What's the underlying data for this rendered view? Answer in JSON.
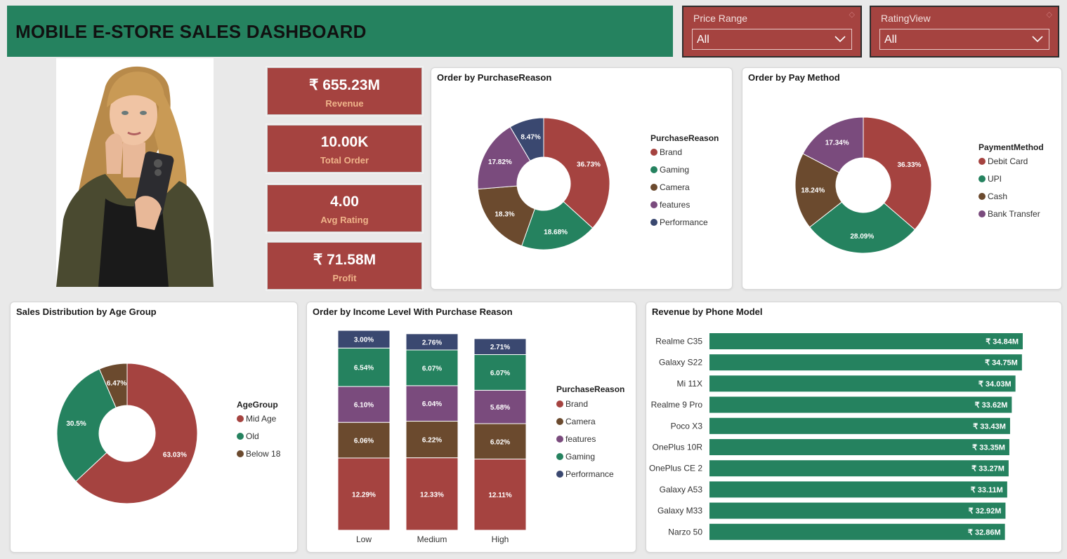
{
  "header": {
    "title": "MOBILE E-STORE SALES DASHBOARD"
  },
  "filters": [
    {
      "label": "Price Range",
      "value": "All"
    },
    {
      "label": "RatingView",
      "value": "All"
    }
  ],
  "kpis": [
    {
      "value": "₹ 655.23M",
      "label": "Revenue"
    },
    {
      "value": "10.00K",
      "label": "Total Order"
    },
    {
      "value": "4.00",
      "label": "Avg Rating"
    },
    {
      "value": "₹ 71.58M",
      "label": "Profit"
    }
  ],
  "colors": {
    "red": "#a54340",
    "green": "#25825f",
    "brown": "#6b4a2e",
    "purple": "#7a4b7d",
    "navy": "#3a4870",
    "accent_label": "#efb48a"
  },
  "chart_data": [
    {
      "id": "purchase",
      "type": "pie",
      "title": "Order by PurchaseReason",
      "legend_title": "PurchaseReason",
      "legend": [
        "Brand",
        "Gaming",
        "Camera",
        "features",
        "Performance"
      ],
      "slices": [
        {
          "name": "Brand",
          "value": 36.73,
          "label": "36.73%",
          "color": "#a54340"
        },
        {
          "name": "Gaming",
          "value": 18.68,
          "label": "18.68%",
          "color": "#25825f"
        },
        {
          "name": "Camera",
          "value": 18.3,
          "label": "18.3%",
          "color": "#6b4a2e"
        },
        {
          "name": "features",
          "value": 17.82,
          "label": "17.82%",
          "color": "#7a4b7d"
        },
        {
          "name": "Performance",
          "value": 8.47,
          "label": "8.47%",
          "color": "#3a4870"
        }
      ]
    },
    {
      "id": "pay",
      "type": "pie",
      "title": "Order by Pay Method",
      "legend_title": "PaymentMethod",
      "legend": [
        "Debit Card",
        "UPI",
        "Cash",
        "Bank Transfer"
      ],
      "slices": [
        {
          "name": "Debit Card",
          "value": 36.33,
          "label": "36.33%",
          "color": "#a54340"
        },
        {
          "name": "UPI",
          "value": 28.09,
          "label": "28.09%",
          "color": "#25825f"
        },
        {
          "name": "Cash",
          "value": 18.24,
          "label": "18.24%",
          "color": "#6b4a2e"
        },
        {
          "name": "Bank Transfer",
          "value": 17.34,
          "label": "17.34%",
          "color": "#7a4b7d"
        }
      ]
    },
    {
      "id": "age",
      "type": "pie",
      "title": "Sales Distribution by Age Group",
      "legend_title": "AgeGroup",
      "legend": [
        "Mid Age",
        "Old",
        "Below 18"
      ],
      "slices": [
        {
          "name": "Mid Age",
          "value": 63.03,
          "label": "63.03%",
          "color": "#a54340"
        },
        {
          "name": "Old",
          "value": 30.5,
          "label": "30.5%",
          "color": "#25825f"
        },
        {
          "name": "Below 18",
          "value": 6.47,
          "label": "6.47%",
          "color": "#6b4a2e"
        }
      ]
    },
    {
      "id": "income",
      "type": "bar",
      "stacked": true,
      "title": "Order by Income Level With Purchase Reason",
      "legend_title": "PurchaseReason",
      "legend": [
        "Brand",
        "Camera",
        "features",
        "Gaming",
        "Performance"
      ],
      "categories": [
        "Low",
        "Medium",
        "High"
      ],
      "series": [
        {
          "name": "Brand",
          "values": [
            12.29,
            12.33,
            12.11
          ],
          "labels": [
            "12.29%",
            "12.33%",
            "12.11%"
          ],
          "color": "#a54340"
        },
        {
          "name": "Camera",
          "values": [
            6.06,
            6.22,
            6.02
          ],
          "labels": [
            "6.06%",
            "6.22%",
            "6.02%"
          ],
          "color": "#6b4a2e"
        },
        {
          "name": "features",
          "values": [
            6.1,
            6.04,
            5.68
          ],
          "labels": [
            "6.10%",
            "6.04%",
            "5.68%"
          ],
          "color": "#7a4b7d"
        },
        {
          "name": "Gaming",
          "values": [
            6.54,
            6.07,
            6.07
          ],
          "labels": [
            "6.54%",
            "6.07%",
            "6.07%"
          ],
          "color": "#25825f"
        },
        {
          "name": "Performance",
          "values": [
            3.0,
            2.76,
            2.71
          ],
          "labels": [
            "3.00%",
            "2.76%",
            "2.71%"
          ],
          "color": "#3a4870"
        }
      ]
    },
    {
      "id": "phone",
      "type": "bar",
      "orientation": "horizontal",
      "title": "Revenue by Phone Model",
      "categories": [
        "Realme C35",
        "Galaxy S22",
        "Mi 11X",
        "Realme 9 Pro",
        "Poco X3",
        "OnePlus 10R",
        "OnePlus CE 2",
        "Galaxy A53",
        "Galaxy M33",
        "Narzo 50"
      ],
      "values": [
        34.84,
        34.75,
        34.03,
        33.62,
        33.43,
        33.35,
        33.27,
        33.11,
        32.92,
        32.86
      ],
      "labels": [
        "₹ 34.84M",
        "₹ 34.75M",
        "₹ 34.03M",
        "₹ 33.62M",
        "₹ 33.43M",
        "₹ 33.35M",
        "₹ 33.27M",
        "₹ 33.11M",
        "₹ 32.92M",
        "₹ 32.86M"
      ],
      "color": "#25825f"
    }
  ]
}
